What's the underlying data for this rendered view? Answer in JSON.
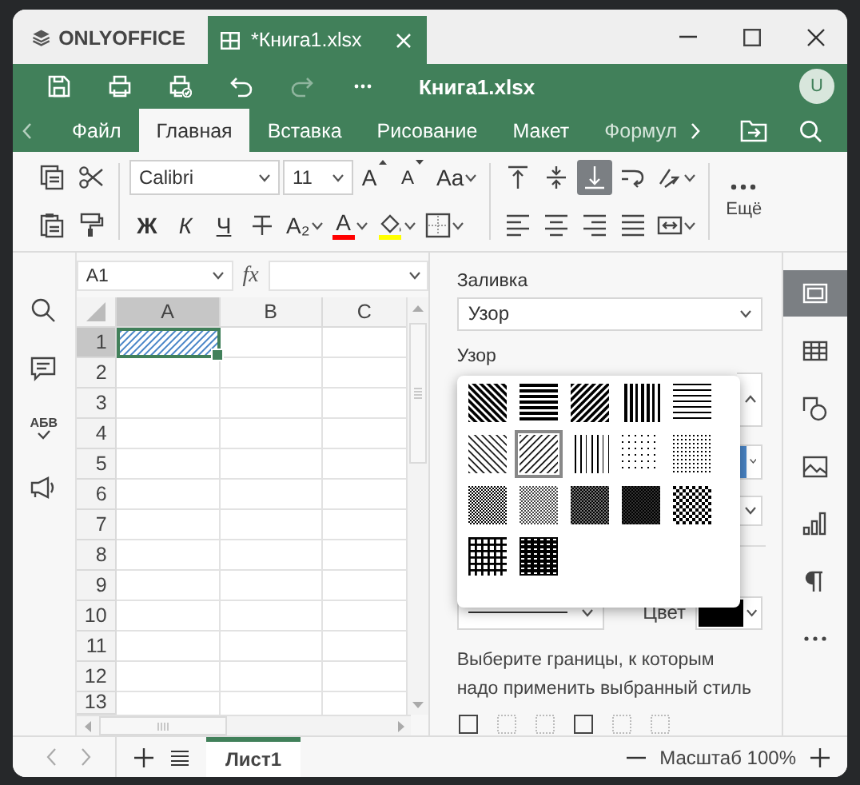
{
  "window": {
    "app": "ONLYOFFICE",
    "tab": "*Книга1.xlsx"
  },
  "header": {
    "title": "Книга1.xlsx",
    "avatar": "U"
  },
  "ribbon_tabs": [
    {
      "label": "Файл",
      "selected": false
    },
    {
      "label": "Главная",
      "selected": true
    },
    {
      "label": "Вставка",
      "selected": false
    },
    {
      "label": "Рисование",
      "selected": false
    },
    {
      "label": "Макет",
      "selected": false
    },
    {
      "label": "Формул",
      "selected": false
    }
  ],
  "toolbar": {
    "font": "Calibri",
    "size": "11",
    "grow": "A",
    "shrink": "A",
    "case": "Aa",
    "bold": "Ж",
    "italic": "К",
    "underline": "Ч",
    "script": "A₂",
    "font_color": "A",
    "more": "Ещё",
    "bottom_align_on": true
  },
  "left_sidebar": {
    "spellcheck": "АБВ"
  },
  "formula_bar": {
    "cell": "A1",
    "fx": "fx"
  },
  "sheet": {
    "columns": [
      {
        "label": "A",
        "selected": true
      },
      {
        "label": "B",
        "selected": false
      },
      {
        "label": "C",
        "selected": false
      }
    ],
    "rows": [
      {
        "label": "1",
        "selected": true
      },
      {
        "label": "2",
        "selected": false
      },
      {
        "label": "3",
        "selected": false
      },
      {
        "label": "4",
        "selected": false
      },
      {
        "label": "5",
        "selected": false
      },
      {
        "label": "6",
        "selected": false
      },
      {
        "label": "7",
        "selected": false
      },
      {
        "label": "8",
        "selected": false
      },
      {
        "label": "9",
        "selected": false
      },
      {
        "label": "10",
        "selected": false
      },
      {
        "label": "11",
        "selected": false
      },
      {
        "label": "12",
        "selected": false
      },
      {
        "label": "13",
        "selected": false
      }
    ]
  },
  "panel": {
    "fill_label": "Заливка",
    "fill_type": "Узор",
    "pattern_label": "Узор",
    "color_label": "Цвет",
    "hint": "Выберите границы, к которым надо применить выбранный стиль",
    "patterns": [
      {
        "kind": "dkdown",
        "selected": false
      },
      {
        "kind": "dkhorz",
        "selected": false
      },
      {
        "kind": "dkup",
        "selected": false
      },
      {
        "kind": "dkvert",
        "selected": false
      },
      {
        "kind": "lthorz",
        "selected": false
      },
      {
        "kind": "ltdown",
        "selected": false
      },
      {
        "kind": "ltup",
        "selected": true
      },
      {
        "kind": "ltvert",
        "selected": false
      },
      {
        "kind": "dots12",
        "selected": false
      },
      {
        "kind": "dots25",
        "selected": false
      },
      {
        "kind": "dots50",
        "selected": false
      },
      {
        "kind": "gray50",
        "selected": false
      },
      {
        "kind": "gray75",
        "selected": false
      },
      {
        "kind": "gray87",
        "selected": false
      },
      {
        "kind": "checker",
        "selected": false
      },
      {
        "kind": "grid",
        "selected": false
      },
      {
        "kind": "trellis",
        "selected": false
      }
    ]
  },
  "right_sidebar": [
    {
      "kind": "cell",
      "selected": true
    },
    {
      "kind": "table",
      "selected": false
    },
    {
      "kind": "shape",
      "selected": false
    },
    {
      "kind": "image",
      "selected": false
    },
    {
      "kind": "chart",
      "selected": false
    },
    {
      "kind": "paragraph",
      "selected": false
    },
    {
      "kind": "more",
      "selected": false
    }
  ],
  "status_bar": {
    "sheets": [
      {
        "label": "Лист1",
        "selected": true
      }
    ],
    "zoom": "Масштаб 100%"
  }
}
